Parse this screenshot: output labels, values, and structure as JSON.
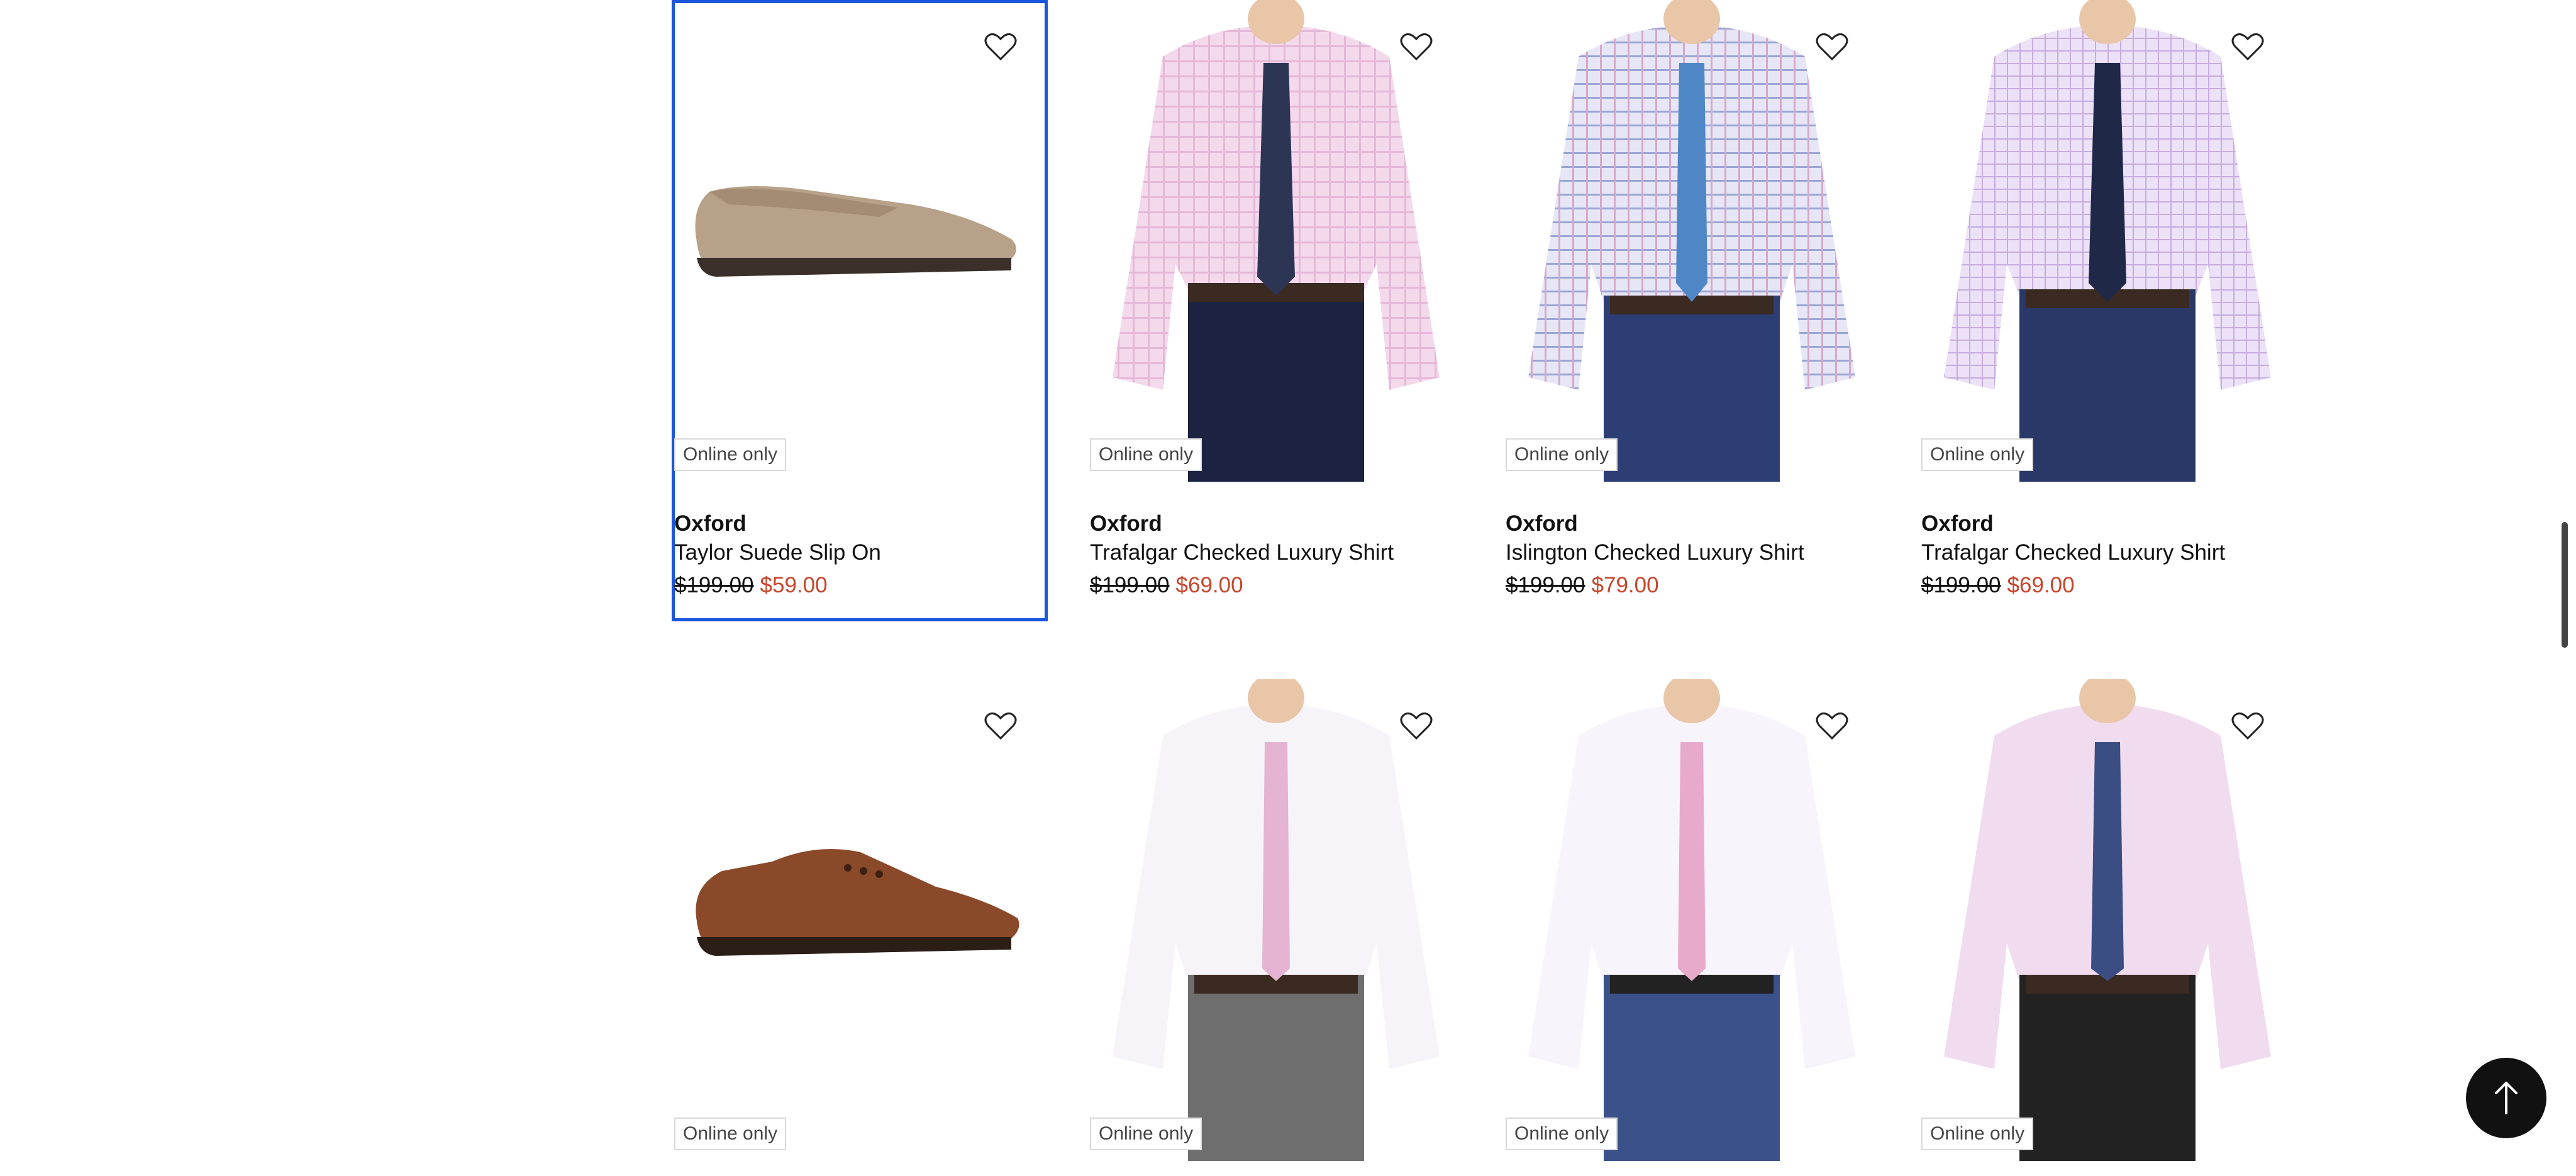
{
  "products": [
    {
      "badge": "Online only",
      "brand": "Oxford",
      "name": "Taylor Suede Slip On",
      "was": "$199.00",
      "now": "$59.00",
      "type": "loafer"
    },
    {
      "badge": "Online only",
      "brand": "Oxford",
      "name": "Trafalgar Checked Luxury Shirt",
      "was": "$199.00",
      "now": "$69.00",
      "type": "shirt-pink"
    },
    {
      "badge": "Online only",
      "brand": "Oxford",
      "name": "Islington Checked Luxury Shirt",
      "was": "$199.00",
      "now": "$79.00",
      "type": "shirt-blue"
    },
    {
      "badge": "Online only",
      "brand": "Oxford",
      "name": "Trafalgar Checked Luxury Shirt",
      "was": "$199.00",
      "now": "$69.00",
      "type": "shirt-lilac"
    },
    {
      "badge": "Online only",
      "type": "brogue"
    },
    {
      "badge": "Online only",
      "type": "shirt-white"
    },
    {
      "badge": "Online only",
      "type": "shirt-white2"
    },
    {
      "badge": "Online only",
      "type": "shirt-pink2"
    }
  ],
  "icons": {
    "wishlist": "heart-outline-icon",
    "scroll_top": "arrow-up-icon"
  },
  "colors": {
    "focus": "#1a56db",
    "sale_price": "#c8452b"
  }
}
